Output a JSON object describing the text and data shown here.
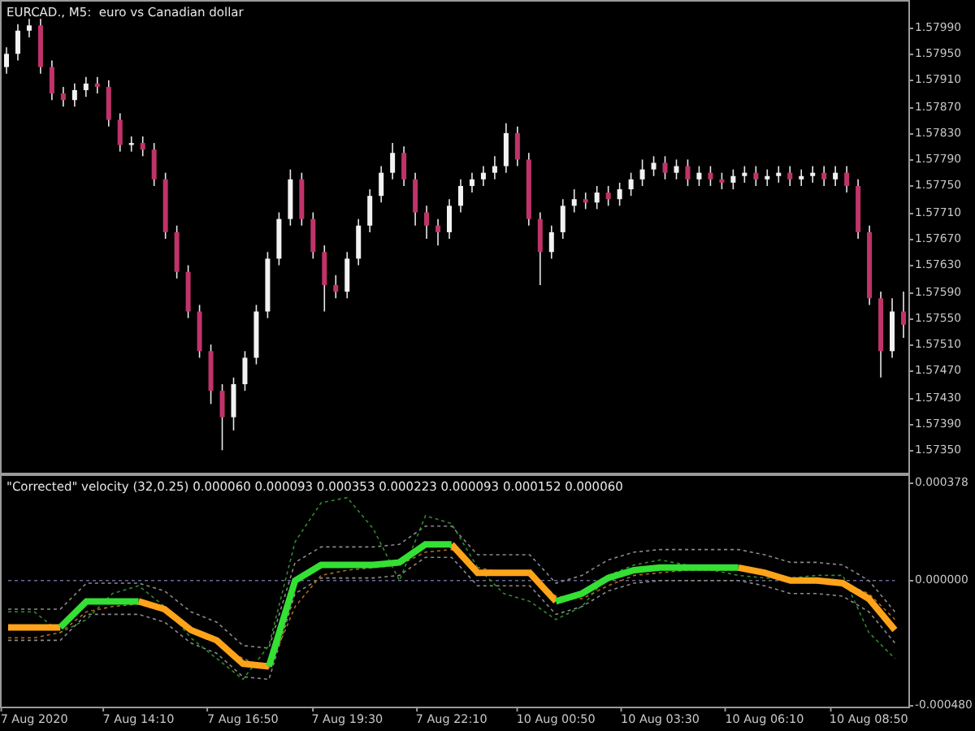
{
  "chart": {
    "title": "EURCAD., M5:  euro vs Canadian dollar",
    "chart_data": {
      "type": "candlestick",
      "ylim": [
        1.57316,
        1.58029
      ],
      "yticks": [
        {
          "value": 1.5799,
          "label": "1.57990"
        },
        {
          "value": 1.5795,
          "label": "1.57950"
        },
        {
          "value": 1.5791,
          "label": "1.57910"
        },
        {
          "value": 1.5787,
          "label": "1.57870"
        },
        {
          "value": 1.5783,
          "label": "1.57830"
        },
        {
          "value": 1.5779,
          "label": "1.57790"
        },
        {
          "value": 1.5775,
          "label": "1.57750"
        },
        {
          "value": 1.5771,
          "label": "1.57710"
        },
        {
          "value": 1.5767,
          "label": "1.57670"
        },
        {
          "value": 1.5763,
          "label": "1.57630"
        },
        {
          "value": 1.5759,
          "label": "1.57590"
        },
        {
          "value": 1.5755,
          "label": "1.57550"
        },
        {
          "value": 1.5751,
          "label": "1.57510"
        },
        {
          "value": 1.5747,
          "label": "1.57470"
        },
        {
          "value": 1.5743,
          "label": "1.57430"
        },
        {
          "value": 1.5739,
          "label": "1.57390"
        },
        {
          "value": 1.5735,
          "label": "1.57350"
        }
      ],
      "categories": [
        null,
        null,
        null,
        null,
        null,
        null,
        null,
        null,
        null,
        null,
        null,
        null,
        null,
        null,
        null,
        null,
        null,
        null,
        null,
        null,
        null,
        null,
        null,
        null,
        null,
        null,
        null,
        null,
        null,
        null,
        null,
        null,
        null,
        null,
        null,
        null,
        null,
        null,
        null,
        null,
        null,
        null,
        null,
        null,
        null,
        null,
        null,
        null,
        null,
        null,
        null,
        null,
        null,
        null,
        null,
        null,
        null,
        null,
        null,
        null,
        null,
        null,
        null,
        null,
        null,
        null,
        null,
        null,
        null,
        null,
        null,
        null,
        null,
        null,
        null,
        null,
        null,
        null,
        null,
        null
      ],
      "ohlc": [
        [
          1.5793,
          1.5796,
          1.5792,
          1.5795
        ],
        [
          1.5795,
          1.57995,
          1.5794,
          1.57985
        ],
        [
          1.57985,
          1.58003,
          1.57975,
          1.57993
        ],
        [
          1.57993,
          1.58003,
          1.5792,
          1.5793
        ],
        [
          1.5793,
          1.5794,
          1.5788,
          1.5789
        ],
        [
          1.5789,
          1.579,
          1.5787,
          1.5788
        ],
        [
          1.5788,
          1.57905,
          1.5787,
          1.57895
        ],
        [
          1.57895,
          1.57915,
          1.57885,
          1.57905
        ],
        [
          1.57905,
          1.57915,
          1.5789,
          1.579
        ],
        [
          1.579,
          1.5791,
          1.5784,
          1.5785
        ],
        [
          1.5785,
          1.5786,
          1.57802,
          1.57812
        ],
        [
          1.57812,
          1.57825,
          1.57802,
          1.57815
        ],
        [
          1.57815,
          1.57825,
          1.57795,
          1.57805
        ],
        [
          1.57805,
          1.57815,
          1.5775,
          1.5776
        ],
        [
          1.5776,
          1.5777,
          1.5767,
          1.5768
        ],
        [
          1.5768,
          1.5769,
          1.5761,
          1.5762
        ],
        [
          1.5762,
          1.5763,
          1.5755,
          1.5756
        ],
        [
          1.5756,
          1.5757,
          1.5749,
          1.575
        ],
        [
          1.575,
          1.5751,
          1.5742,
          1.5744
        ],
        [
          1.5744,
          1.5745,
          1.5735,
          1.574
        ],
        [
          1.574,
          1.5746,
          1.5738,
          1.5745
        ],
        [
          1.5745,
          1.575,
          1.5744,
          1.5749
        ],
        [
          1.5749,
          1.5757,
          1.5748,
          1.5756
        ],
        [
          1.5756,
          1.5765,
          1.5755,
          1.5764
        ],
        [
          1.5764,
          1.5771,
          1.5763,
          1.577
        ],
        [
          1.577,
          1.57775,
          1.5769,
          1.5776
        ],
        [
          1.5776,
          1.5777,
          1.5769,
          1.577
        ],
        [
          1.577,
          1.5771,
          1.5764,
          1.5765
        ],
        [
          1.5765,
          1.5766,
          1.5756,
          1.576
        ],
        [
          1.576,
          1.57615,
          1.5758,
          1.5759
        ],
        [
          1.5759,
          1.5765,
          1.5758,
          1.5764
        ],
        [
          1.5764,
          1.577,
          1.5763,
          1.5769
        ],
        [
          1.5769,
          1.57745,
          1.5768,
          1.57735
        ],
        [
          1.57735,
          1.5778,
          1.57725,
          1.5777
        ],
        [
          1.5777,
          1.57815,
          1.5776,
          1.578
        ],
        [
          1.578,
          1.5781,
          1.5775,
          1.5776
        ],
        [
          1.5776,
          1.5777,
          1.5769,
          1.5771
        ],
        [
          1.5771,
          1.5772,
          1.5767,
          1.5769
        ],
        [
          1.5769,
          1.577,
          1.5766,
          1.5768
        ],
        [
          1.5768,
          1.5773,
          1.5767,
          1.5772
        ],
        [
          1.5772,
          1.5776,
          1.5771,
          1.5775
        ],
        [
          1.5775,
          1.5777,
          1.5774,
          1.5776
        ],
        [
          1.5776,
          1.5778,
          1.5775,
          1.5777
        ],
        [
          1.5777,
          1.57795,
          1.5776,
          1.5778
        ],
        [
          1.5778,
          1.57845,
          1.5777,
          1.5783
        ],
        [
          1.5783,
          1.5784,
          1.5778,
          1.5779
        ],
        [
          1.5779,
          1.578,
          1.5769,
          1.577
        ],
        [
          1.577,
          1.5771,
          1.576,
          1.5765
        ],
        [
          1.5765,
          1.5769,
          1.5764,
          1.5768
        ],
        [
          1.5768,
          1.5773,
          1.5767,
          1.5772
        ],
        [
          1.5772,
          1.57745,
          1.5771,
          1.5773
        ],
        [
          1.5773,
          1.5774,
          1.57715,
          1.57725
        ],
        [
          1.57725,
          1.5775,
          1.57715,
          1.5774
        ],
        [
          1.5774,
          1.5775,
          1.5772,
          1.5773
        ],
        [
          1.5773,
          1.57755,
          1.5772,
          1.57745
        ],
        [
          1.57745,
          1.5777,
          1.57735,
          1.5776
        ],
        [
          1.5776,
          1.5779,
          1.5775,
          1.57775
        ],
        [
          1.57775,
          1.57795,
          1.57765,
          1.57785
        ],
        [
          1.57785,
          1.57795,
          1.5776,
          1.5777
        ],
        [
          1.5777,
          1.5779,
          1.5776,
          1.5778
        ],
        [
          1.5778,
          1.5779,
          1.5775,
          1.5776
        ],
        [
          1.5776,
          1.5778,
          1.5775,
          1.5777
        ],
        [
          1.5777,
          1.5778,
          1.5775,
          1.5776
        ],
        [
          1.5776,
          1.5777,
          1.57745,
          1.57755
        ],
        [
          1.57755,
          1.57775,
          1.57745,
          1.57765
        ],
        [
          1.57765,
          1.5778,
          1.57755,
          1.5777
        ],
        [
          1.5777,
          1.5778,
          1.5775,
          1.5776
        ],
        [
          1.5776,
          1.57775,
          1.5775,
          1.57765
        ],
        [
          1.57765,
          1.5778,
          1.57755,
          1.5777
        ],
        [
          1.5777,
          1.5778,
          1.5775,
          1.5776
        ],
        [
          1.5776,
          1.57775,
          1.5775,
          1.57765
        ],
        [
          1.57765,
          1.5778,
          1.57755,
          1.5777
        ],
        [
          1.5777,
          1.5778,
          1.5775,
          1.5776
        ],
        [
          1.5776,
          1.5778,
          1.5775,
          1.5777
        ],
        [
          1.5777,
          1.5778,
          1.5774,
          1.5775
        ],
        [
          1.5775,
          1.5776,
          1.5767,
          1.5768
        ],
        [
          1.5768,
          1.5769,
          1.5757,
          1.5758
        ],
        [
          1.5758,
          1.5759,
          1.5746,
          1.575
        ],
        [
          1.575,
          1.5758,
          1.5749,
          1.5756
        ],
        [
          1.5756,
          1.5759,
          1.5752,
          1.5754
        ]
      ]
    }
  },
  "indicator": {
    "label": "\"Corrected\" velocity (32,0.25) 0.000060 0.000093 0.000353 0.000223 0.000093 0.000152 0.000060",
    "chart_data": {
      "type": "line",
      "ylim": [
        -0.000485,
        0.000403
      ],
      "yticks": [
        {
          "value": 0.000378,
          "label": "0.000378"
        },
        {
          "value": 0,
          "label": "0.000000"
        },
        {
          "value": -0.00048,
          "label": "-0.000480"
        }
      ],
      "categories": [
        null,
        "7 Aug 2020",
        null,
        null,
        null,
        "7 Aug 14:10",
        null,
        null,
        null,
        "7 Aug 16:50",
        null,
        null,
        null,
        "7 Aug 19:30",
        null,
        null,
        null,
        "7 Aug 22:10",
        null,
        null,
        null,
        "10 Aug 00:50",
        null,
        null,
        null,
        "10 Aug 03:30",
        null,
        null,
        null,
        "10 Aug 06:10",
        null,
        null,
        null,
        "10 Aug 08:50",
        null
      ],
      "series": [
        {
          "color": "#6a6a9a",
          "line_style": "dashed",
          "values": [
            0,
            0,
            0,
            0,
            0,
            0,
            0,
            0,
            0,
            0,
            0,
            0,
            0,
            0,
            0,
            0,
            0,
            0,
            0,
            0,
            0,
            0,
            0,
            0,
            0,
            0,
            0,
            0,
            0,
            0,
            0,
            0,
            0,
            0,
            0
          ]
        },
        {
          "color": "#8a8a8a",
          "line_style": "dashed",
          "values": [
            -0.00011,
            -0.00011,
            -0.00011,
            -1e-05,
            -1e-05,
            -1e-05,
            -4e-05,
            -0.00012,
            -0.00016,
            -0.00025,
            -0.00026,
            7e-05,
            0.00013,
            0.00013,
            0.00013,
            0.00014,
            0.00021,
            0.00021,
            0.0001,
            0.0001,
            0.0001,
            -1e-05,
            2e-05,
            8e-05,
            0.00011,
            0.00012,
            0.00012,
            0.00012,
            0.00012,
            0.0001,
            7e-05,
            7e-05,
            6e-05,
            0.0,
            -0.00012
          ]
        },
        {
          "color": "#8a8a8a",
          "line_style": "dashed",
          "values": [
            -0.00023,
            -0.00023,
            -0.00023,
            -0.00013,
            -0.00013,
            -0.00013,
            -0.00016,
            -0.00024,
            -0.00028,
            -0.00037,
            -0.00038,
            -5e-05,
            1e-05,
            1e-05,
            1e-05,
            2e-05,
            9e-05,
            9e-05,
            -2e-05,
            -2e-05,
            -2e-05,
            -0.00013,
            -0.0001,
            -4e-05,
            -1e-05,
            0.0,
            0.0,
            0.0,
            0.0,
            -2e-05,
            -5e-05,
            -5e-05,
            -6e-05,
            -0.00012,
            -0.00024
          ]
        },
        {
          "color": "#2e8b2e",
          "line_style": "dashed",
          "values": [
            -0.00012,
            -0.00012,
            -0.0002,
            -0.00015,
            -5e-05,
            -2e-05,
            -0.0001,
            -0.00022,
            -0.0003,
            -0.00038,
            -0.00025,
            0.00015,
            0.0003,
            0.00032,
            0.0002,
            0.0,
            0.00025,
            0.00022,
            5e-05,
            -5e-05,
            -8e-05,
            -0.00015,
            -0.0001,
            2e-05,
            6e-05,
            8e-05,
            6e-05,
            4e-05,
            2e-05,
            1e-05,
            1e-05,
            2e-05,
            2e-05,
            -0.0002,
            -0.0003
          ]
        },
        {
          "color": "#b06a1a",
          "line_style": "dashed",
          "values": [
            -0.00022,
            -0.00022,
            -0.0002,
            -0.00012,
            -0.0001,
            -9e-05,
            -0.00012,
            -0.00018,
            -0.00024,
            -0.0003,
            -0.00034,
            -0.0001,
            2e-05,
            4e-05,
            5e-05,
            6e-05,
            0.00011,
            0.00012,
            5e-05,
            3e-05,
            2e-05,
            -6e-05,
            -7e-05,
            -2e-05,
            2e-05,
            3e-05,
            4e-05,
            4e-05,
            4e-05,
            3e-05,
            1e-05,
            0.0,
            -1e-05,
            -5e-05,
            -0.00015
          ]
        },
        {
          "color": "#ffa31a",
          "line_style": "solid",
          "values": [
            -0.00018,
            -0.00018,
            -0.00018,
            null,
            null,
            -8e-05,
            -0.00011,
            -0.00019,
            -0.00023,
            -0.00032,
            -0.00033,
            null,
            null,
            null,
            null,
            null,
            null,
            0.00014,
            3e-05,
            3e-05,
            3e-05,
            -8e-05,
            null,
            null,
            null,
            null,
            null,
            null,
            5e-05,
            3e-05,
            0,
            0,
            -1e-05,
            -7e-05,
            -0.00019
          ]
        },
        {
          "color": "#33e033",
          "line_style": "solid",
          "values": [
            null,
            null,
            -0.00018,
            -8e-05,
            -8e-05,
            -8e-05,
            null,
            null,
            null,
            null,
            -0.00033,
            0,
            6e-05,
            6e-05,
            6e-05,
            7e-05,
            0.00014,
            0.00014,
            null,
            null,
            null,
            -8e-05,
            -5e-05,
            1e-05,
            4e-05,
            5e-05,
            5e-05,
            5e-05,
            5e-05,
            null,
            null,
            null,
            null,
            null,
            null
          ]
        }
      ]
    }
  }
}
